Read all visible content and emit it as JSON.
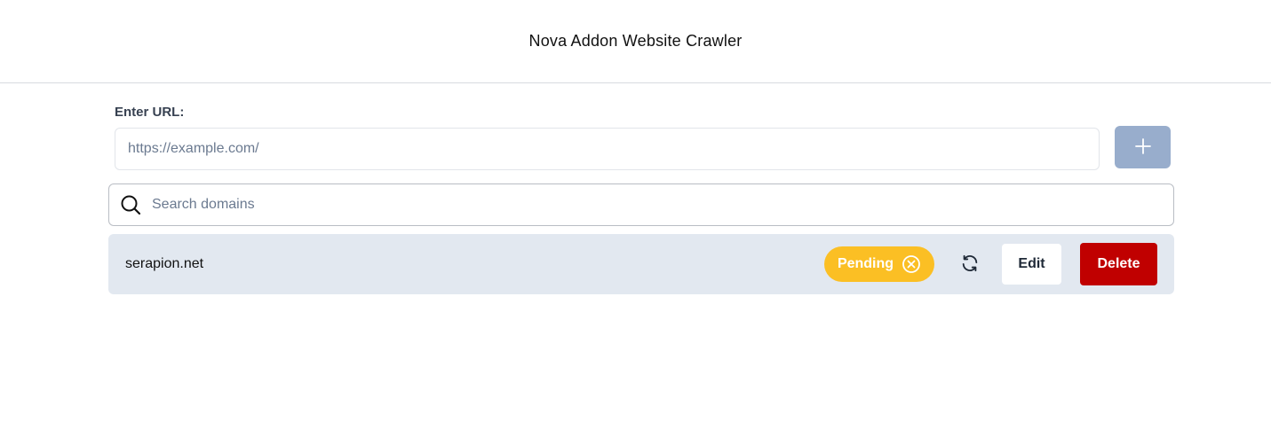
{
  "header": {
    "title": "Nova Addon Website Crawler"
  },
  "url_form": {
    "label": "Enter URL:",
    "placeholder": "https://example.com/",
    "value": "",
    "add_icon": "plus-icon"
  },
  "search": {
    "placeholder": "Search domains",
    "value": "",
    "icon": "search-icon"
  },
  "domains": [
    {
      "name": "serapion.net",
      "status": "Pending",
      "status_color": "#fbbf24",
      "status_icon": "cancel-circle-icon",
      "refresh_icon": "refresh-icon",
      "edit_label": "Edit",
      "delete_label": "Delete"
    }
  ],
  "colors": {
    "add_button": "#98adcc",
    "row_background": "#e2e8f0",
    "delete_button": "#c00000"
  }
}
